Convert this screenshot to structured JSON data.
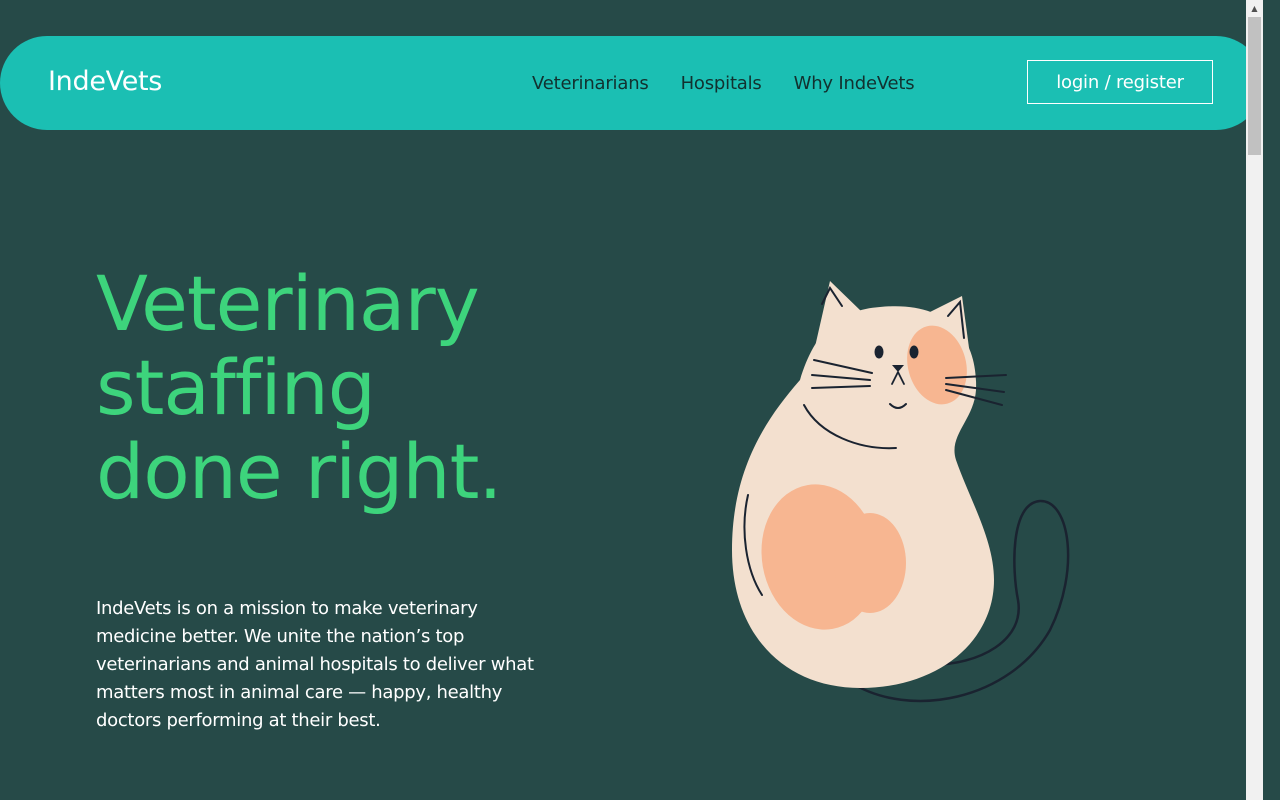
{
  "header": {
    "logo": "IndeVets",
    "nav": [
      {
        "label": "Veterinarians"
      },
      {
        "label": "Hospitals"
      },
      {
        "label": "Why IndeVets"
      }
    ],
    "login_label": "login / register"
  },
  "hero": {
    "title_lines": [
      "Veterinary",
      "staffing",
      "done right."
    ],
    "description": "IndeVets is on a mission to make veterinary medicine better. We unite the nation’s top veterinarians and animal hospitals to deliver what matters most in animal care — happy, healthy doctors performing at their best."
  },
  "illustration": {
    "icon": "cat-illustration"
  },
  "colors": {
    "background": "#264a48",
    "header": "#1bbfb3",
    "accent_green": "#3dd47c",
    "cat_body": "#f3e0cf",
    "cat_spots": "#f7b691"
  },
  "scrollbar": {
    "up_arrow": "▲"
  }
}
